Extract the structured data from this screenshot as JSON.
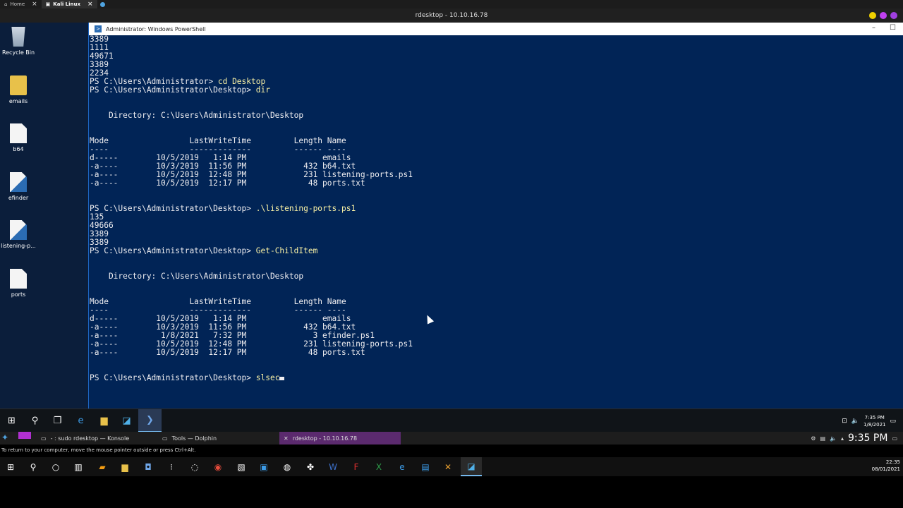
{
  "browser_tabs": [
    {
      "label": "Home",
      "active": false
    },
    {
      "label": "Kali Linux",
      "active": true
    }
  ],
  "rdesktop_title": "rdesktop - 10.10.16.78",
  "desktop_icons": [
    {
      "label": "Recycle Bin",
      "icon": "recycle-bin-icon"
    },
    {
      "label": "emails",
      "icon": "folder-icon"
    },
    {
      "label": "b64",
      "icon": "file-icon"
    },
    {
      "label": "efinder",
      "icon": "powershell-script-icon"
    },
    {
      "label": "listening-p...",
      "icon": "powershell-script-icon"
    },
    {
      "label": "ports",
      "icon": "file-icon"
    }
  ],
  "ps_window": {
    "title": "Administrator: Windows PowerShell",
    "lines": [
      {
        "t": "3389"
      },
      {
        "t": "1111"
      },
      {
        "t": "49671"
      },
      {
        "t": "3389"
      },
      {
        "t": "2234"
      },
      {
        "p": "PS C:\\Users\\Administrator> ",
        "c": "cd Desktop"
      },
      {
        "p": "PS C:\\Users\\Administrator\\Desktop> ",
        "c": "dir"
      },
      {
        "t": ""
      },
      {
        "t": ""
      },
      {
        "t": "    Directory: C:\\Users\\Administrator\\Desktop"
      },
      {
        "t": ""
      },
      {
        "t": ""
      },
      {
        "t": "Mode                 LastWriteTime         Length Name"
      },
      {
        "t": "----                 -------------         ------ ----"
      },
      {
        "t": "d-----        10/5/2019   1:14 PM                emails"
      },
      {
        "t": "-a----        10/3/2019  11:56 PM            432 b64.txt"
      },
      {
        "t": "-a----        10/5/2019  12:48 PM            231 listening-ports.ps1"
      },
      {
        "t": "-a----        10/5/2019  12:17 PM             48 ports.txt"
      },
      {
        "t": ""
      },
      {
        "t": ""
      },
      {
        "p": "PS C:\\Users\\Administrator\\Desktop> ",
        "c": ".\\listening-ports.ps1"
      },
      {
        "t": "135"
      },
      {
        "t": "49666"
      },
      {
        "t": "3389"
      },
      {
        "t": "3389"
      },
      {
        "p": "PS C:\\Users\\Administrator\\Desktop> ",
        "c": "Get-ChildItem"
      },
      {
        "t": ""
      },
      {
        "t": ""
      },
      {
        "t": "    Directory: C:\\Users\\Administrator\\Desktop"
      },
      {
        "t": ""
      },
      {
        "t": ""
      },
      {
        "t": "Mode                 LastWriteTime         Length Name"
      },
      {
        "t": "----                 -------------         ------ ----"
      },
      {
        "t": "d-----        10/5/2019   1:14 PM                emails"
      },
      {
        "t": "-a----        10/3/2019  11:56 PM            432 b64.txt"
      },
      {
        "t": "-a----         1/8/2021   7:32 PM              3 efinder.ps1"
      },
      {
        "t": "-a----        10/5/2019  12:48 PM            231 listening-ports.ps1"
      },
      {
        "t": "-a----        10/5/2019  12:17 PM             48 ports.txt"
      },
      {
        "t": ""
      },
      {
        "t": ""
      },
      {
        "p": "PS C:\\Users\\Administrator\\Desktop> ",
        "c": "slsec",
        "cursor": true
      }
    ]
  },
  "win_taskbar": {
    "buttons": [
      "start-icon",
      "search-icon",
      "task-view-icon",
      "edge-icon",
      "file-explorer-icon",
      "powershell-ise-icon",
      "powershell-icon"
    ],
    "clock_time": "7:35 PM",
    "clock_date": "1/8/2021"
  },
  "kali_panel": {
    "tasks": [
      {
        "label": "- : sudo rdesktop — Konsole",
        "active": false
      },
      {
        "label": "Tools — Dolphin",
        "active": false
      },
      {
        "label": "rdesktop - 10.10.16.78",
        "active": true
      }
    ],
    "time": "9:35 PM"
  },
  "hint_text": "To return to your computer, move the mouse pointer outside or press Ctrl+Alt.",
  "host_taskbar": {
    "time": "22:35",
    "date": "08/01/2021"
  },
  "colors": {
    "ps_background": "#012456",
    "ps_text": "#eeedf0",
    "ps_command": "#f9f1a5",
    "kali_active_task": "#5b2a6e"
  }
}
